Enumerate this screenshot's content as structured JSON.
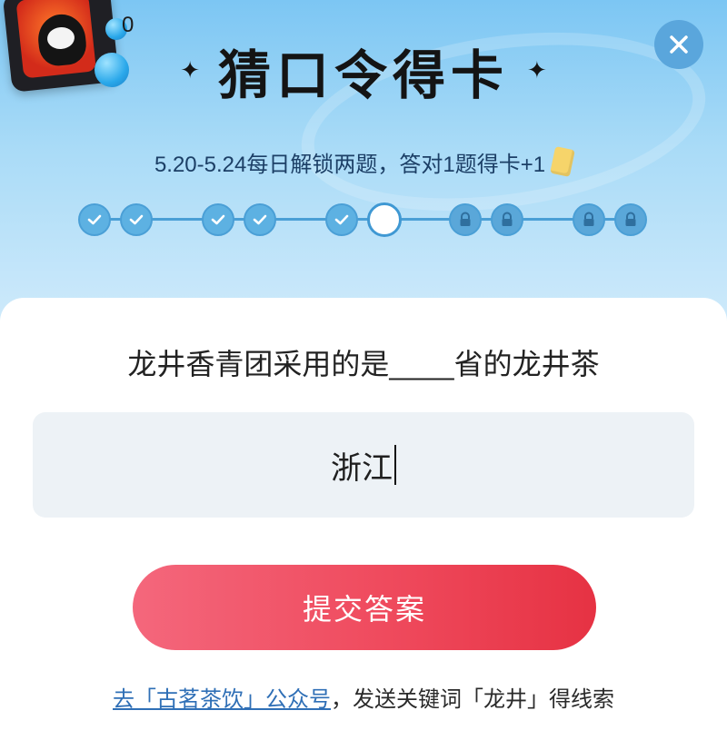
{
  "header": {
    "card_count": "0",
    "title": "猜口令得卡",
    "subtitle": "5.20-5.24每日解锁两题，答对1题得卡+1",
    "close_icon": "close-icon"
  },
  "progress": {
    "nodes": [
      {
        "state": "done"
      },
      {
        "state": "done"
      },
      {
        "state": "done"
      },
      {
        "state": "done"
      },
      {
        "state": "done"
      },
      {
        "state": "current"
      },
      {
        "state": "locked"
      },
      {
        "state": "locked"
      },
      {
        "state": "locked"
      },
      {
        "state": "locked"
      }
    ]
  },
  "question": {
    "text": "龙井香青团采用的是____省的龙井茶"
  },
  "answer": {
    "value": "浙江"
  },
  "submit": {
    "label": "提交答案"
  },
  "hint": {
    "link_text": "去「古茗茶饮」公众号",
    "rest_text": "，发送关键词「龙井」得线索"
  },
  "colors": {
    "header_top": "#7cc6f3",
    "submit_start": "#f4677c",
    "submit_end": "#e63243",
    "node_blue": "#5db1e2",
    "link": "#2f6fb6"
  }
}
